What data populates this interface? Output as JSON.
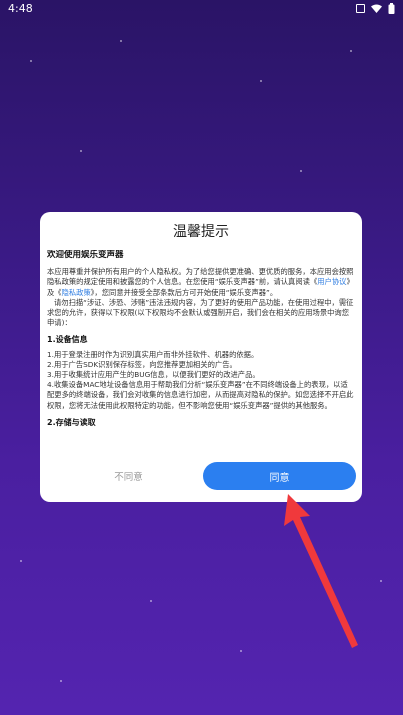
{
  "status_bar": {
    "time": "4:48"
  },
  "dialog": {
    "title": "温馨提示",
    "welcome": "欢迎使用娱乐变声器",
    "intro_1": "本应用尊重并保护所有用户的个人隐私权。为了给您提供更准确、更优质的服务，本应用会按照隐私政策的规定使用和披露您的个人信息。在您使用“娱乐变声器”前，请认真阅读《",
    "link_user_agreement": "用户协议",
    "intro_and": "》及《",
    "link_privacy_policy": "隐私政策",
    "intro_2": "》，您同意并接受全部条款后方可开始使用“娱乐变声器”。",
    "notice": "请勿扫描“涉证、涉恐、涉赌”违法违规内容，为了更好的使用产品功能，在使用过程中，需征求您的允许，获得以下权限(以下权限均不会默认或强制开启，我们会在相关的应用场景中询您申请)：",
    "section_1_title": "1.设备信息",
    "section_1_items": [
      "1.用于登录注册时作为识别真实用户而非外挂软件、机器的依据。",
      "2.用于广告SDK识别保存标签，向您推荐更加相关的广告。",
      "3.用于收集统计应用产生的BUG信息，以便我们更好的改进产品。",
      "4.收集设备MAC地址设备信息用于帮助我们分析“娱乐变声器”在不同终端设备上的表现，以适配更多的终端设备，我们会对收集的信息进行加密，从而提高对隐私的保护。如您选择不开启此权限，您将无法使用此权限特定的功能，但不影响您使用“娱乐变声器”提供的其他服务。"
    ],
    "section_2_title": "2.存储与读取",
    "disagree_label": "不同意",
    "agree_label": "同意"
  },
  "colors": {
    "background_top": "#2a1466",
    "background_bottom": "#5424b0",
    "agree_button": "#2b7ff0",
    "link": "#2f7de1",
    "arrow": "#f0393c"
  }
}
